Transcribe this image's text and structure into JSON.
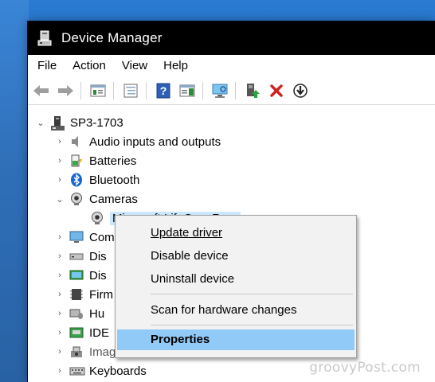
{
  "window": {
    "title": "Device Manager"
  },
  "menu": [
    "File",
    "Action",
    "View",
    "Help"
  ],
  "toolbar": {
    "buttons": [
      "back-icon",
      "forward-icon",
      "properties-icon",
      "tree-view-icon",
      "help-icon",
      "toggle-pane-icon",
      "scan-hardware-icon",
      "update-driver-icon",
      "uninstall-icon",
      "disable-device-icon"
    ]
  },
  "tree": {
    "root": "SP3-1703",
    "items": [
      {
        "label": "Audio inputs and outputs",
        "icon": "speaker-icon",
        "expanded": false
      },
      {
        "label": "Batteries",
        "icon": "battery-icon",
        "expanded": false
      },
      {
        "label": "Bluetooth",
        "icon": "bluetooth-icon",
        "expanded": false
      },
      {
        "label": "Cameras",
        "icon": "camera-icon",
        "expanded": true
      },
      {
        "label": "Microsoft LifeCam Rear",
        "icon": "webcam-icon",
        "child": true,
        "selected": true
      },
      {
        "label": "Computer",
        "icon": "computer-icon",
        "expanded": false
      },
      {
        "label": "Disk drives",
        "icon": "disk-icon",
        "expanded": false
      },
      {
        "label": "Display adapters",
        "icon": "display-icon",
        "expanded": false
      },
      {
        "label": "Firmware",
        "icon": "firmware-icon",
        "expanded": false
      },
      {
        "label": "Human Interface Devices",
        "icon": "hid-icon",
        "expanded": false
      },
      {
        "label": "IDE ATA/ATAPI controllers",
        "icon": "ide-icon",
        "expanded": false
      },
      {
        "label": "Imaging devices",
        "icon": "imaging-icon",
        "expanded": false
      },
      {
        "label": "Keyboards",
        "icon": "keyboard-icon",
        "expanded": false
      }
    ]
  },
  "tree_visible": {
    "computer": "Com",
    "disk": "Dis",
    "display": "Dis",
    "firmware": "Firm",
    "hid": "Hu",
    "ide": "IDE",
    "imaging": "Imaging devices",
    "camera_child": "Microsoft LifeCam Rear"
  },
  "context_menu": {
    "update": "Update driver",
    "disable": "Disable device",
    "uninstall": "Uninstall device",
    "scan": "Scan for hardware changes",
    "properties": "Properties"
  },
  "watermark": "groovyPost.com",
  "colors": {
    "titlebar": "#000000",
    "highlight": "#91c9f7",
    "desktop": "#1e63b2"
  }
}
